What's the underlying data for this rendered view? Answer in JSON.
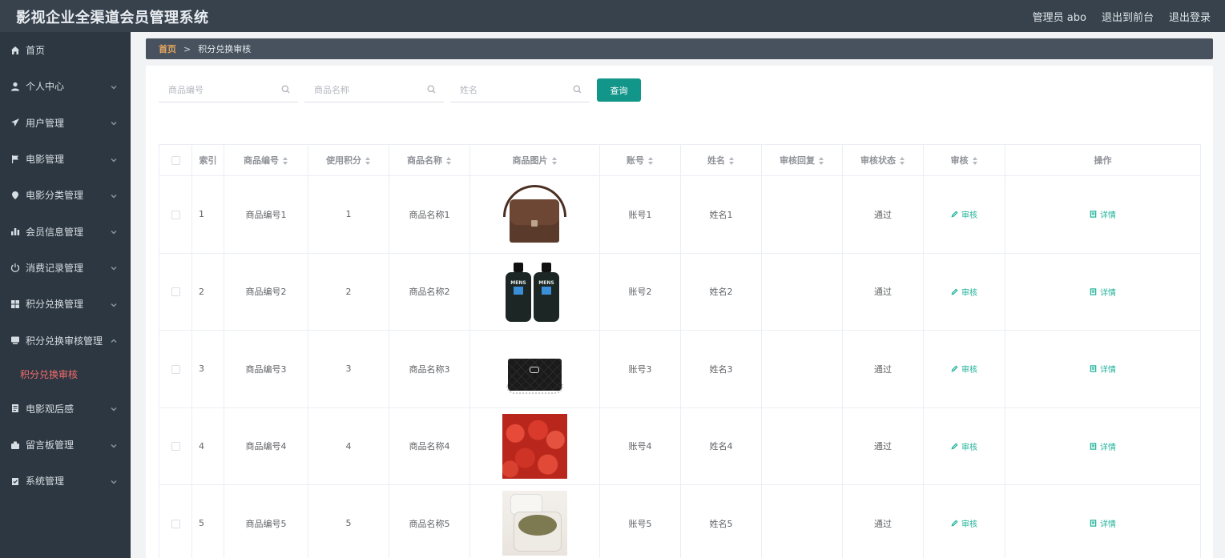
{
  "header": {
    "title": "影视企业全渠道会员管理系统",
    "admin_label": "管理员 abo",
    "back_to_front": "退出到前台",
    "logout": "退出登录"
  },
  "sidebar": {
    "items": [
      {
        "label": "首页",
        "icon": "home-icon",
        "has_arrow": false
      },
      {
        "label": "个人中心",
        "icon": "user-icon",
        "has_arrow": true
      },
      {
        "label": "用户管理",
        "icon": "send-icon",
        "has_arrow": true
      },
      {
        "label": "电影管理",
        "icon": "flag-icon",
        "has_arrow": true
      },
      {
        "label": "电影分类管理",
        "icon": "location-icon",
        "has_arrow": true
      },
      {
        "label": "会员信息管理",
        "icon": "bar-chart-icon",
        "has_arrow": true
      },
      {
        "label": "消费记录管理",
        "icon": "power-icon",
        "has_arrow": true
      },
      {
        "label": "积分兑换管理",
        "icon": "grid-icon",
        "has_arrow": true
      },
      {
        "label": "积分兑换审核管理",
        "icon": "monitor-icon",
        "has_arrow": true,
        "expanded": true
      },
      {
        "label": "电影观后感",
        "icon": "document-icon",
        "has_arrow": true
      },
      {
        "label": "留言板管理",
        "icon": "briefcase-icon",
        "has_arrow": true
      },
      {
        "label": "系统管理",
        "icon": "clipboard-icon",
        "has_arrow": true
      }
    ],
    "active_sub": "积分兑换审核"
  },
  "breadcrumb": {
    "home": "首页",
    "separator": ">",
    "current": "积分兑换审核"
  },
  "search": {
    "product_code_placeholder": "商品编号",
    "product_name_placeholder": "商品名称",
    "name_placeholder": "姓名",
    "query_label": "查询"
  },
  "table": {
    "headers": [
      "索引",
      "商品编号",
      "使用积分",
      "商品名称",
      "商品图片",
      "账号",
      "姓名",
      "审核回复",
      "审核状态",
      "审核",
      "操作"
    ],
    "rows": [
      {
        "index": "1",
        "code": "商品编号1",
        "points": "1",
        "name": "商品名称1",
        "image": "leather-bag",
        "account": "账号1",
        "person": "姓名1",
        "reply": "",
        "status": "通过",
        "review": "审核",
        "detail": "详情"
      },
      {
        "index": "2",
        "code": "商品编号2",
        "points": "2",
        "name": "商品名称2",
        "image": "mens-cleanser-bottles",
        "account": "账号2",
        "person": "姓名2",
        "reply": "",
        "status": "通过",
        "review": "审核",
        "detail": "详情"
      },
      {
        "index": "3",
        "code": "商品编号3",
        "points": "3",
        "name": "商品名称3",
        "image": "quilted-purse",
        "account": "账号3",
        "person": "姓名3",
        "reply": "",
        "status": "通过",
        "review": "审核",
        "detail": "详情"
      },
      {
        "index": "4",
        "code": "商品编号4",
        "points": "4",
        "name": "商品名称4",
        "image": "cherries",
        "account": "账号4",
        "person": "姓名4",
        "reply": "",
        "status": "通过",
        "review": "审核",
        "detail": "详情"
      },
      {
        "index": "5",
        "code": "商品编号5",
        "points": "5",
        "name": "商品名称5",
        "image": "cream-jars",
        "account": "账号5",
        "person": "姓名5",
        "reply": "",
        "status": "通过",
        "review": "审核",
        "detail": "详情"
      }
    ],
    "bottle_label": "MENS"
  },
  "colors": {
    "topbar": "#37424d",
    "sidebar": "#2d3741",
    "accent": "#13968a",
    "active_sub": "#f56c6c",
    "breadcrumb_home": "#e5a65e"
  }
}
